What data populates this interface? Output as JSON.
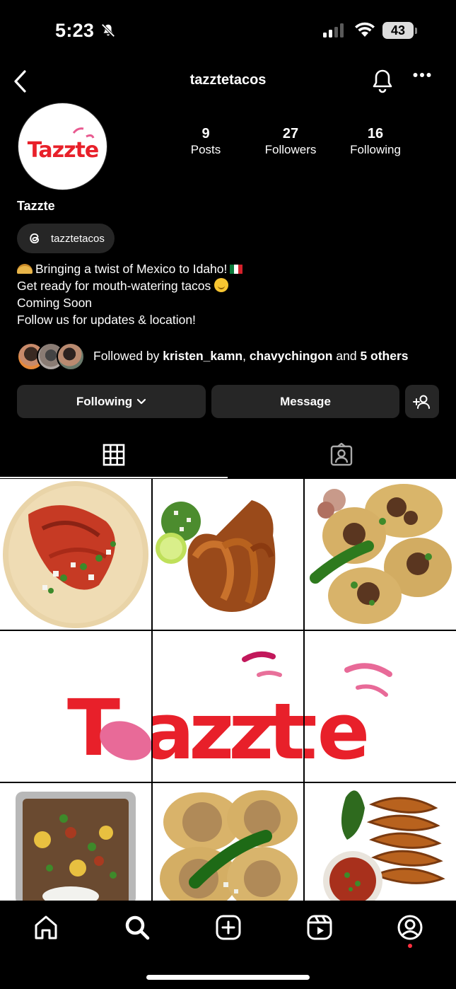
{
  "status_bar": {
    "time": "5:23",
    "battery": "43"
  },
  "header": {
    "username": "tazztetacos"
  },
  "profile": {
    "logo_text": "Tazzte",
    "stats": [
      {
        "value": "9",
        "label": "Posts"
      },
      {
        "value": "27",
        "label": "Followers"
      },
      {
        "value": "16",
        "label": "Following"
      }
    ],
    "display_name": "Tazzte",
    "threads_handle": "tazztetacos",
    "bio": [
      "Bringing a twist of Mexico to Idaho!",
      "Get ready for mouth-watering tacos",
      "Coming Soon",
      "Follow us for updates & location!"
    ],
    "followed_by": {
      "prefix": "Followed by ",
      "user1": "kristen_kamn",
      "sep": ", ",
      "user2": "chavychingon",
      "and": " and ",
      "others": "5 others"
    }
  },
  "actions": {
    "following_label": "Following",
    "message_label": "Message"
  },
  "tabs": [
    "grid-icon",
    "tagged-icon"
  ],
  "grid_posts": [
    "pastor-taco",
    "birria-tacos",
    "asada-tacos",
    "logo-left",
    "logo-center",
    "logo-right",
    "nachos-tray",
    "chicken-tacos",
    "quesabirria-stack"
  ],
  "nav": [
    "home-icon",
    "search-icon",
    "create-icon",
    "reels-icon",
    "profile-icon"
  ]
}
